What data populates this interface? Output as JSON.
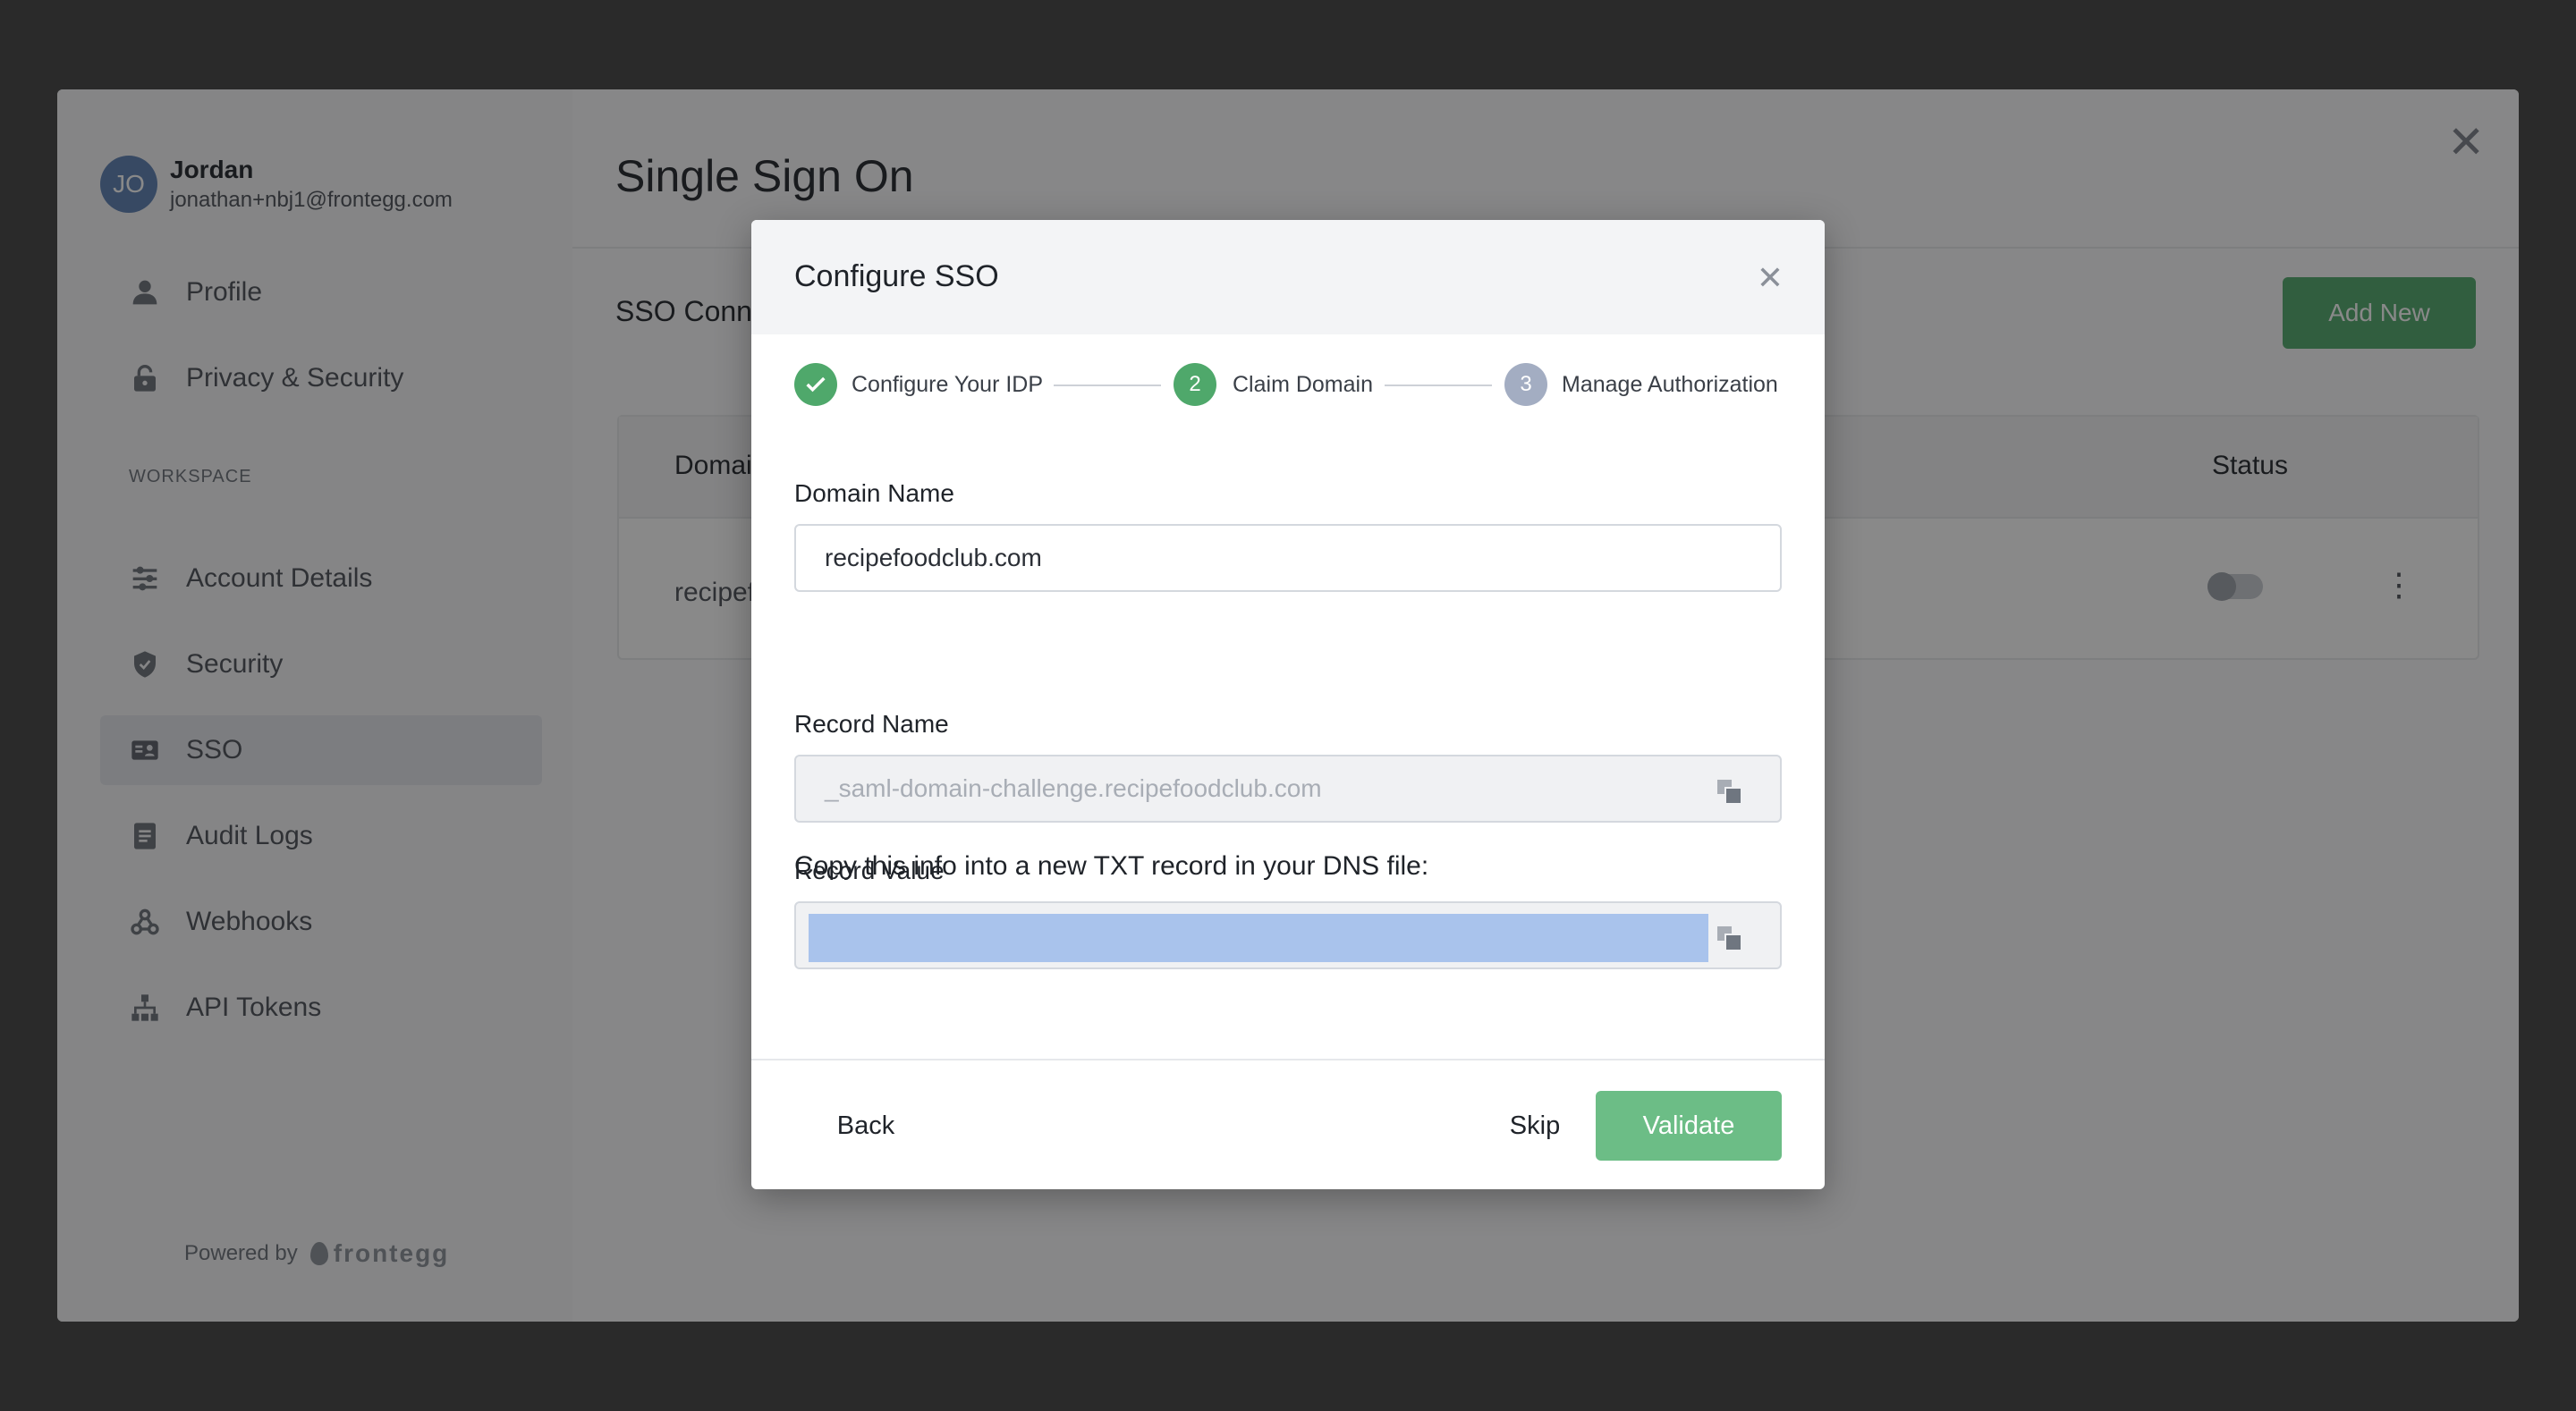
{
  "user": {
    "initials": "JO",
    "name": "Jordan",
    "email": "jonathan+nbj1@frontegg.com"
  },
  "sidebar": {
    "items_top": [
      {
        "label": "Profile",
        "icon": "person-icon"
      },
      {
        "label": "Privacy & Security",
        "icon": "lock-icon"
      }
    ],
    "section_label": "WORKSPACE",
    "items_workspace": [
      {
        "label": "Account Details",
        "icon": "sliders-icon"
      },
      {
        "label": "Security",
        "icon": "shield-icon"
      },
      {
        "label": "SSO",
        "icon": "id-card-icon",
        "active": true
      },
      {
        "label": "Audit Logs",
        "icon": "document-icon"
      },
      {
        "label": "Webhooks",
        "icon": "webhook-icon"
      },
      {
        "label": "API Tokens",
        "icon": "hierarchy-icon"
      }
    ],
    "powered_by": "Powered by",
    "brand": "frontegg"
  },
  "main": {
    "title": "Single Sign On",
    "section": "SSO Conn",
    "add_new": "Add New",
    "table": {
      "col_domain": "Domai",
      "col_status": "Status",
      "row_domain": "recipef"
    }
  },
  "modal": {
    "title": "Configure SSO",
    "steps": [
      {
        "number": "1",
        "label": "Configure Your IDP",
        "state": "done"
      },
      {
        "number": "2",
        "label": "Claim Domain",
        "state": "active"
      },
      {
        "number": "3",
        "label": "Manage Authorization",
        "state": "pending"
      }
    ],
    "domain_label": "Domain Name",
    "domain_value": "recipefoodclub.com",
    "info": "Copy this info into a new TXT record in your DNS file:",
    "record_name_label": "Record Name",
    "record_name_value": "_saml-domain-challenge.recipefoodclub.com",
    "record_value_label": "Record Value",
    "back": "Back",
    "skip": "Skip",
    "validate": "Validate"
  },
  "colors": {
    "accent": "#4fa86b",
    "step_pending": "#a3adc2",
    "selection": "#a9c3ec"
  }
}
